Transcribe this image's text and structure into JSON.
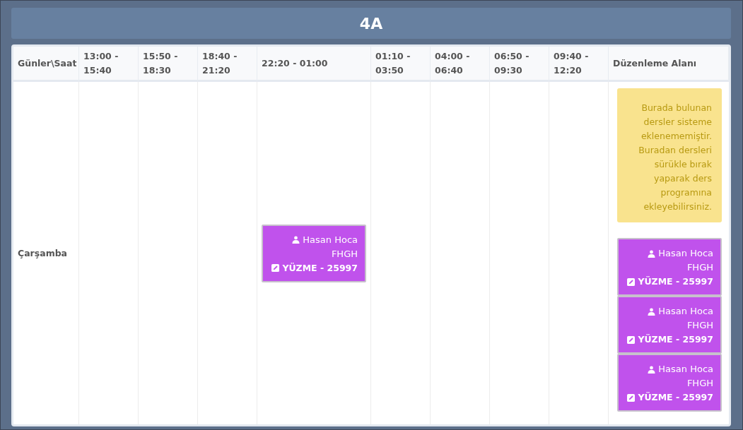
{
  "title": "4A",
  "columns": [
    "Günler\\Saat",
    "13:00 - 15:40",
    "15:50 - 18:30",
    "18:40 - 21:20",
    "22:20 - 01:00",
    "01:10 - 03:50",
    "04:00 - 06:40",
    "06:50 - 09:30",
    "09:40 - 12:20",
    "Düzenleme Alanı"
  ],
  "rows": [
    {
      "day": "Çarşamba",
      "slots": [
        {
          "kind": "empty"
        },
        {
          "kind": "empty"
        },
        {
          "kind": "empty"
        },
        {
          "kind": "lesson",
          "teacher": "Hasan Hoca",
          "code": "FHGH",
          "course": "YÜZME - 25997"
        },
        {
          "kind": "empty"
        },
        {
          "kind": "empty"
        },
        {
          "kind": "empty"
        },
        {
          "kind": "empty"
        }
      ]
    }
  ],
  "edit_area": {
    "note": "Burada bulunan dersler sisteme eklenememiştir. Buradan dersleri sürükle bırak yaparak ders programına ekleyebilirsiniz.",
    "lessons": [
      {
        "teacher": "Hasan Hoca",
        "code": "FHGH",
        "course": "YÜZME - 25997"
      },
      {
        "teacher": "Hasan Hoca",
        "code": "FHGH",
        "course": "YÜZME - 25997"
      },
      {
        "teacher": "Hasan Hoca",
        "code": "FHGH",
        "course": "YÜZME - 25997"
      }
    ]
  }
}
